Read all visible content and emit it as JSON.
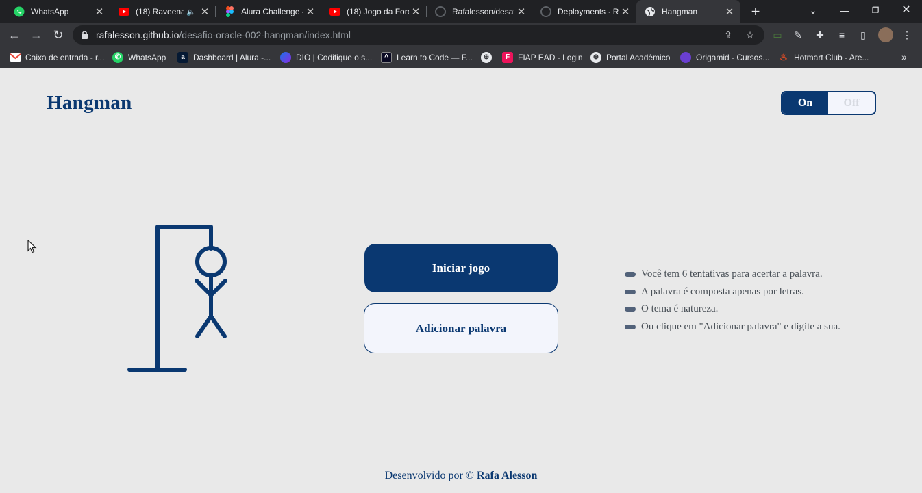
{
  "browser": {
    "tabs": [
      {
        "title": "WhatsApp",
        "icon": "whatsapp-icon",
        "color": "#25d366"
      },
      {
        "title": "(18) Raveena",
        "icon": "youtube-icon",
        "color": "#ff0000",
        "audio": true
      },
      {
        "title": "Alura Challenge -",
        "icon": "figma-icon",
        "color": "#f24e1e"
      },
      {
        "title": "(18) Jogo da Forc",
        "icon": "youtube-icon",
        "color": "#ff0000"
      },
      {
        "title": "Rafalesson/desaf",
        "icon": "github-icon",
        "color": "#202124"
      },
      {
        "title": "Deployments · Ra",
        "icon": "github-icon",
        "color": "#202124"
      },
      {
        "title": "Hangman",
        "icon": "globe-icon",
        "color": "#e8eaed",
        "active": true
      }
    ],
    "url_host": "rafalesson.github.io",
    "url_path": "/desafio-oracle-002-hangman/index.html",
    "bookmarks": [
      {
        "label": "Caixa de entrada - r...",
        "icon": "gmail-icon",
        "color": "#ea4335",
        "glyph": "M"
      },
      {
        "label": "WhatsApp",
        "icon": "whatsapp-icon",
        "color": "#25d366",
        "glyph": "✆"
      },
      {
        "label": "Dashboard | Alura -...",
        "icon": "alura-icon",
        "color": "#051933",
        "glyph": "a"
      },
      {
        "label": "DIO | Codifique o s...",
        "icon": "dio-icon",
        "color": "#1a73e8",
        "glyph": ""
      },
      {
        "label": "Learn to Code — F...",
        "icon": "freecodecamp-icon",
        "color": "#0a0a23",
        "glyph": "^"
      },
      {
        "label": "",
        "icon": "globe-icon",
        "color": "#35363a",
        "glyph": "⊕"
      },
      {
        "label": "FIAP EAD - Login",
        "icon": "fiap-icon",
        "color": "#ed145b",
        "glyph": "F"
      },
      {
        "label": "Portal Acadêmico",
        "icon": "globe-icon",
        "color": "#35363a",
        "glyph": "⊕"
      },
      {
        "label": "Origamid - Cursos...",
        "icon": "origamid-icon",
        "color": "#6a3fd1",
        "glyph": ""
      },
      {
        "label": "Hotmart Club - Are...",
        "icon": "hotmart-icon",
        "color": "#f04e23",
        "glyph": "♨"
      }
    ]
  },
  "page": {
    "logo": "Hangman",
    "toggle": {
      "on": "On",
      "off": "Off"
    },
    "start_button": "Iniciar jogo",
    "add_word_button": "Adicionar palavra",
    "rules": [
      "Você tem 6 tentativas para acertar a palavra.",
      "A palavra é composta apenas por letras.",
      "O tema é natureza.",
      "Ou clique em \"Adicionar palavra\" e digite a sua."
    ],
    "footer_prefix": "Desenvolvido por ©",
    "footer_author": "Rafa Alesson"
  },
  "colors": {
    "primary": "#0a3871",
    "background": "#e9e9e9",
    "text": "#495057"
  }
}
